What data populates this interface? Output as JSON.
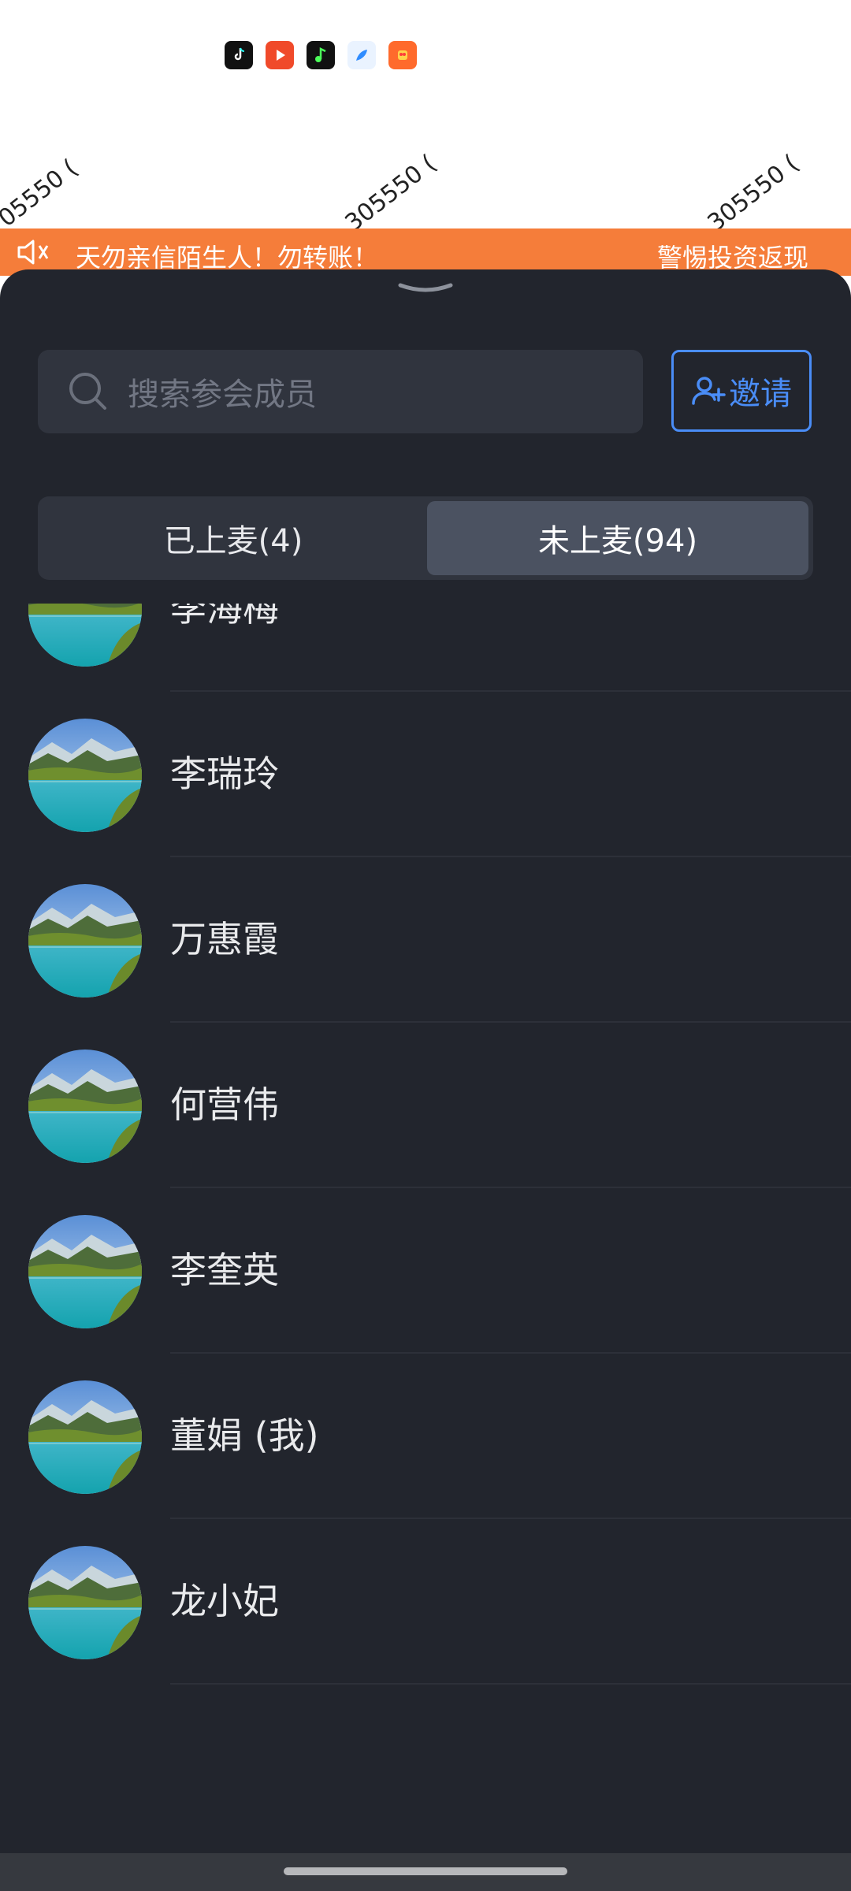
{
  "status_bar": {
    "app_icons": [
      "tiktok-icon",
      "video-play-icon",
      "music-icon",
      "feather-icon",
      "shopping-icon"
    ],
    "watermarks": [
      "05550 (",
      "305550 (",
      "305550 ("
    ]
  },
  "banner": {
    "text_left": "天勿亲信陌生人！勿转账！",
    "text_right": "警惕投资返现"
  },
  "sheet": {
    "search": {
      "placeholder": "搜索参会成员"
    },
    "invite_label": "邀请",
    "tabs": [
      {
        "label": "已上麦(4)",
        "selected": false
      },
      {
        "label": "未上麦(94)",
        "selected": true
      }
    ],
    "members": [
      {
        "name": "李海梅"
      },
      {
        "name": "李瑞玲"
      },
      {
        "name": "万惠霞"
      },
      {
        "name": "何营伟"
      },
      {
        "name": "李奎英"
      },
      {
        "name": "董娟 (我)"
      },
      {
        "name": "龙小妃"
      }
    ]
  },
  "colors": {
    "banner": "#f57d3a",
    "sheet_bg": "#22252d",
    "accent": "#4a8df7"
  }
}
